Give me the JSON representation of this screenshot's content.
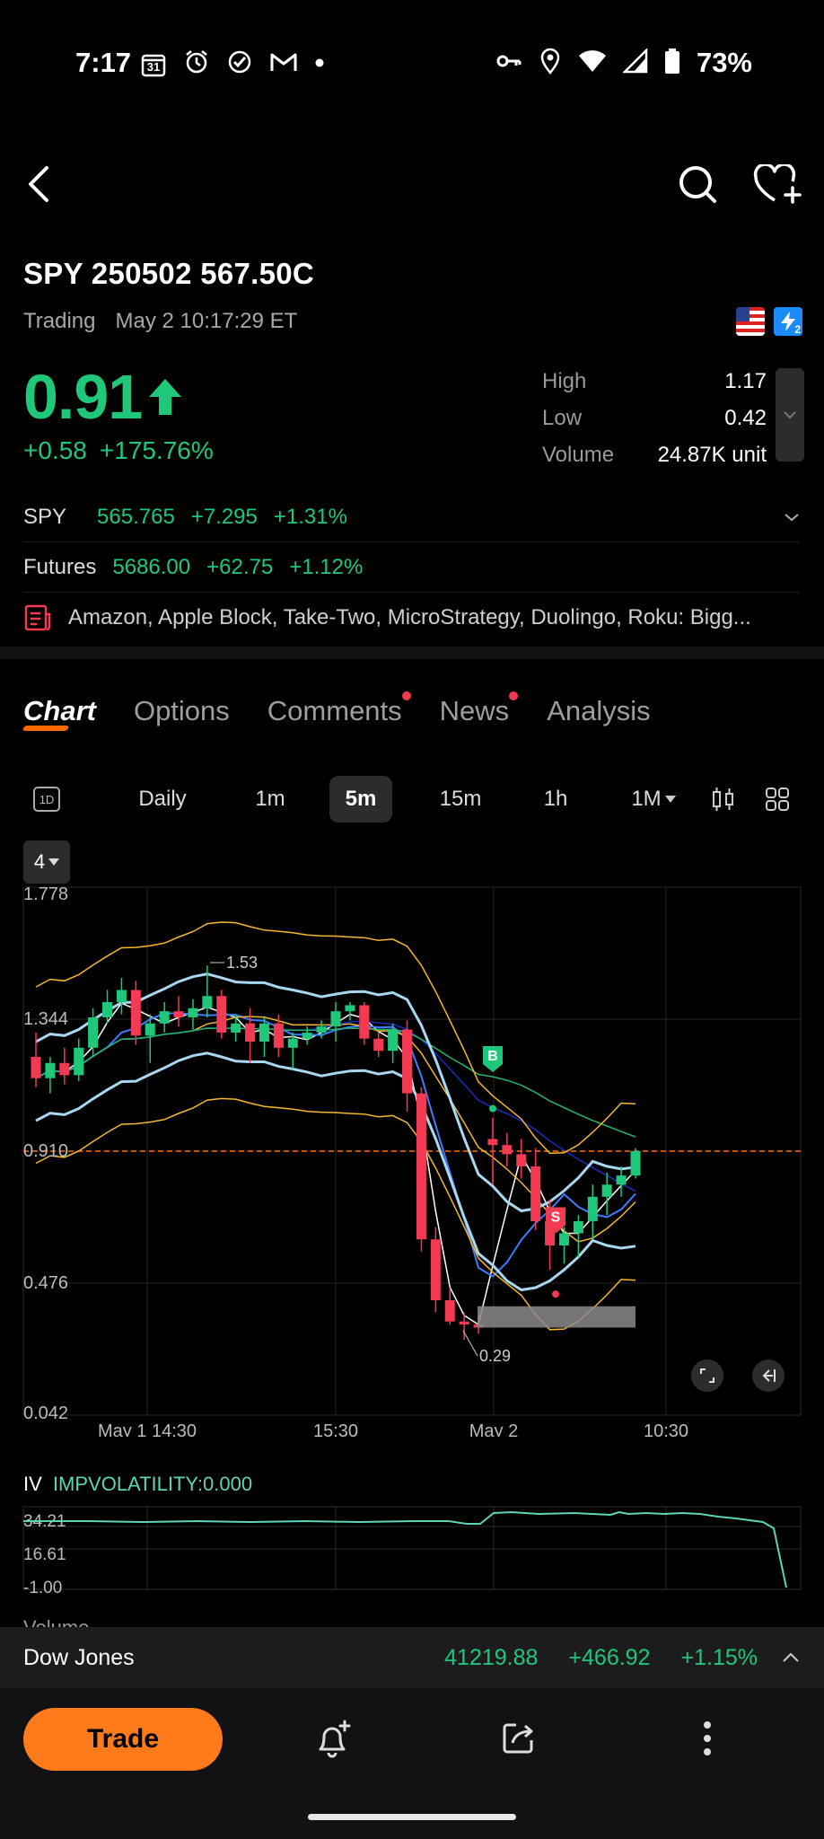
{
  "status_bar": {
    "time": "7:17",
    "calendar_day": "31",
    "battery": "73%",
    "icons_left": [
      "calendar-icon",
      "alarm-icon",
      "check-circle-icon",
      "gmail-icon",
      "dot-icon"
    ],
    "icons_right": [
      "vpn-key-icon",
      "location-icon",
      "wifi-icon",
      "signal-icon",
      "battery-icon"
    ]
  },
  "header": {
    "back_icon": "back-arrow-icon",
    "search_icon": "search-icon",
    "watchlist_icon": "heart-plus-icon"
  },
  "quote": {
    "symbol": "SPY 250502 567.50C",
    "status": "Trading",
    "timestamp": "May 2 10:17:29 ET",
    "price": "0.91",
    "change": "+0.58",
    "change_pct": "+175.76%",
    "price_color": "#1fc77a",
    "badge_1": "2",
    "stats": [
      {
        "label": "High",
        "value": "1.17"
      },
      {
        "label": "Low",
        "value": "0.42"
      },
      {
        "label": "Volume",
        "value": "24.87K unit"
      }
    ]
  },
  "underlying": {
    "name": "SPY",
    "price": "565.765",
    "change": "+7.295",
    "change_pct": "+1.31%"
  },
  "futures": {
    "name": "Futures",
    "price": "5686.00",
    "change": "+62.75",
    "change_pct": "+1.12%"
  },
  "news_headline": "Amazon, Apple Block, Take-Two, MicroStrategy, Duolingo, Roku: Bigg...",
  "tabs": [
    {
      "label": "Chart",
      "active": true
    },
    {
      "label": "Options"
    },
    {
      "label": "Comments",
      "dot": true
    },
    {
      "label": "News",
      "dot": true
    },
    {
      "label": "Analysis"
    }
  ],
  "timeframes": {
    "intraday": "1D",
    "daily": "Daily",
    "m1": "1m",
    "m5": "5m",
    "m15": "15m",
    "h1": "1h",
    "month": "1M",
    "selected": "5m"
  },
  "indicator_count": "4",
  "chart": {
    "y_ticks": [
      "1.778",
      "1.344",
      "0.910",
      "0.476",
      "0.042"
    ],
    "x_ticks": [
      "May 1 14:30",
      "15:30",
      "May 2",
      "10:30"
    ],
    "high_annotation": "1.53",
    "low_annotation": "0.29",
    "buy_marker": "B",
    "sell_marker": "S",
    "current_price_line_color": "#ff6a00",
    "up_color": "#1fc77a",
    "down_color": "#f23a53"
  },
  "chart_data": {
    "type": "candlestick",
    "ylim": [
      0.042,
      1.778
    ],
    "yticks": [
      1.778,
      1.344,
      0.91,
      0.476,
      0.042
    ],
    "x_tick_labels": [
      "May 1 14:30",
      "15:30",
      "May 2",
      "10:30"
    ],
    "last_price": 0.91,
    "annotations": [
      {
        "label": "1.53"
      },
      {
        "label": "0.29"
      }
    ],
    "candles": [
      {
        "o": 1.22,
        "h": 1.3,
        "l": 1.12,
        "c": 1.15
      },
      {
        "o": 1.15,
        "h": 1.22,
        "l": 1.1,
        "c": 1.2
      },
      {
        "o": 1.2,
        "h": 1.25,
        "l": 1.13,
        "c": 1.16
      },
      {
        "o": 1.16,
        "h": 1.28,
        "l": 1.14,
        "c": 1.25
      },
      {
        "o": 1.25,
        "h": 1.38,
        "l": 1.22,
        "c": 1.35
      },
      {
        "o": 1.35,
        "h": 1.44,
        "l": 1.33,
        "c": 1.4
      },
      {
        "o": 1.4,
        "h": 1.48,
        "l": 1.36,
        "c": 1.44
      },
      {
        "o": 1.44,
        "h": 1.47,
        "l": 1.26,
        "c": 1.29
      },
      {
        "o": 1.29,
        "h": 1.36,
        "l": 1.2,
        "c": 1.33
      },
      {
        "o": 1.33,
        "h": 1.4,
        "l": 1.3,
        "c": 1.37
      },
      {
        "o": 1.37,
        "h": 1.42,
        "l": 1.32,
        "c": 1.35
      },
      {
        "o": 1.35,
        "h": 1.41,
        "l": 1.31,
        "c": 1.38
      },
      {
        "o": 1.38,
        "h": 1.52,
        "l": 1.35,
        "c": 1.42
      },
      {
        "o": 1.42,
        "h": 1.44,
        "l": 1.28,
        "c": 1.3
      },
      {
        "o": 1.3,
        "h": 1.36,
        "l": 1.27,
        "c": 1.33
      },
      {
        "o": 1.33,
        "h": 1.38,
        "l": 1.2,
        "c": 1.27
      },
      {
        "o": 1.27,
        "h": 1.35,
        "l": 1.22,
        "c": 1.33
      },
      {
        "o": 1.33,
        "h": 1.36,
        "l": 1.22,
        "c": 1.25
      },
      {
        "o": 1.25,
        "h": 1.3,
        "l": 1.18,
        "c": 1.28
      },
      {
        "o": 1.28,
        "h": 1.32,
        "l": 1.26,
        "c": 1.3
      },
      {
        "o": 1.3,
        "h": 1.34,
        "l": 1.28,
        "c": 1.32
      },
      {
        "o": 1.32,
        "h": 1.4,
        "l": 1.27,
        "c": 1.37
      },
      {
        "o": 1.37,
        "h": 1.4,
        "l": 1.34,
        "c": 1.39
      },
      {
        "o": 1.39,
        "h": 1.4,
        "l": 1.26,
        "c": 1.28
      },
      {
        "o": 1.28,
        "h": 1.3,
        "l": 1.22,
        "c": 1.24
      },
      {
        "o": 1.24,
        "h": 1.33,
        "l": 1.2,
        "c": 1.31
      },
      {
        "o": 1.31,
        "h": 1.34,
        "l": 1.04,
        "c": 1.1
      },
      {
        "o": 1.1,
        "h": 1.12,
        "l": 0.58,
        "c": 0.62
      },
      {
        "o": 0.62,
        "h": 0.66,
        "l": 0.38,
        "c": 0.42
      },
      {
        "o": 0.42,
        "h": 0.46,
        "l": 0.34,
        "c": 0.35
      },
      {
        "o": 0.35,
        "h": 0.38,
        "l": 0.29,
        "c": 0.34
      },
      {
        "o": 0.34,
        "h": 0.37,
        "l": 0.31,
        "c": 0.33
      },
      {
        "o": 0.95,
        "h": 1.02,
        "l": 0.8,
        "c": 0.93
      },
      {
        "o": 0.93,
        "h": 0.97,
        "l": 0.86,
        "c": 0.9
      },
      {
        "o": 0.9,
        "h": 0.95,
        "l": 0.82,
        "c": 0.86
      },
      {
        "o": 0.86,
        "h": 0.92,
        "l": 0.65,
        "c": 0.68
      },
      {
        "o": 0.68,
        "h": 0.75,
        "l": 0.52,
        "c": 0.6
      },
      {
        "o": 0.6,
        "h": 0.66,
        "l": 0.54,
        "c": 0.64
      },
      {
        "o": 0.64,
        "h": 0.7,
        "l": 0.56,
        "c": 0.68
      },
      {
        "o": 0.68,
        "h": 0.8,
        "l": 0.62,
        "c": 0.76
      },
      {
        "o": 0.76,
        "h": 0.84,
        "l": 0.7,
        "c": 0.8
      },
      {
        "o": 0.8,
        "h": 0.86,
        "l": 0.76,
        "c": 0.83
      },
      {
        "o": 0.83,
        "h": 0.92,
        "l": 0.82,
        "c": 0.91
      }
    ]
  },
  "iv": {
    "label": "IV",
    "indicator": "IMPVOLATILITY:0.000",
    "y_ticks": [
      "34.21",
      "16.61",
      "-1.00"
    ],
    "color": "#5fd3b8"
  },
  "volume_peek": "Volume",
  "ticker_bar": {
    "name": "Dow Jones",
    "price": "41219.88",
    "change": "+466.92",
    "change_pct": "+1.15%"
  },
  "bottom": {
    "trade_label": "Trade",
    "trade_color": "#ff7a1a"
  }
}
